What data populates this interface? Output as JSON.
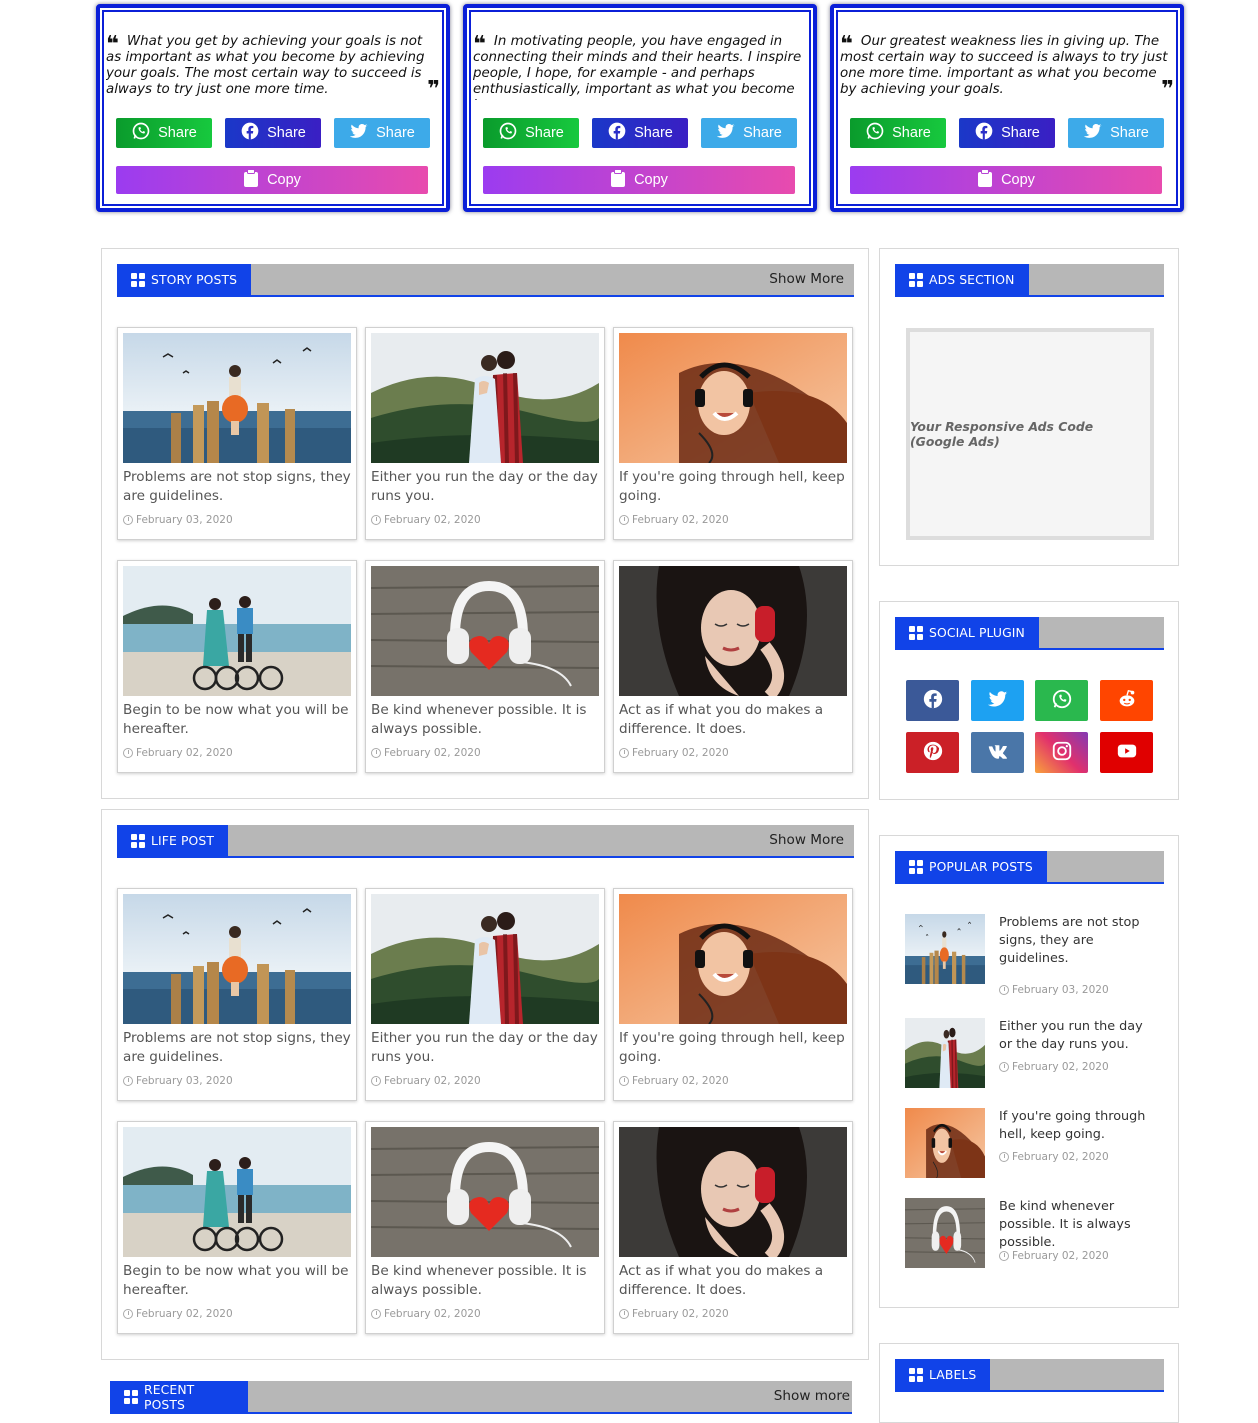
{
  "quotes": [
    {
      "text": "What you get by achieving your goals is not as important as what you become by achieving your goals. The most certain way to succeed is always to try just one more time."
    },
    {
      "text": "In motivating people, you have engaged in connecting their minds and their hearts. I inspire people, I hope, for example - and perhaps enthusiastically, important as what you become by"
    },
    {
      "text": "Our greatest weakness lies in giving up. The most certain way to succeed is always to try just one more time. important as what you become by achieving your goals."
    }
  ],
  "share_buttons": {
    "whatsapp": "Share",
    "facebook": "Share",
    "twitter": "Share",
    "copy": "Copy"
  },
  "story_section": {
    "title": "STORY POSTS",
    "show_more": "Show More"
  },
  "life_section": {
    "title": "LIFE POST",
    "show_more": "Show More"
  },
  "recent_section": {
    "title": "RECENT POSTS",
    "show_more": "Show more"
  },
  "posts": [
    {
      "title": "Problems are not stop signs, they are guidelines.",
      "date": "February 03, 2020",
      "image": "guitar-girl-pier"
    },
    {
      "title": "Either you run the day or the day runs you.",
      "date": "February 02, 2020",
      "image": "couple-hug-mountains"
    },
    {
      "title": "If you're going through hell, keep going.",
      "date": "February 02, 2020",
      "image": "woman-headphones-orange"
    },
    {
      "title": "Begin to be now what you will be hereafter.",
      "date": "February 02, 2020",
      "image": "couple-bicycles-beach"
    },
    {
      "title": "Be kind whenever possible. It is always possible.",
      "date": "February 02, 2020",
      "image": "headphones-heart-wood"
    },
    {
      "title": "Act as if what you do makes a difference. It does.",
      "date": "February 02, 2020",
      "image": "woman-red-headphones"
    }
  ],
  "sidebar": {
    "ads_title": "ADS SECTION",
    "ads_text": "Your Responsive Ads Code (Google Ads)",
    "social_title": "SOCIAL PLUGIN",
    "social_icons": [
      "facebook-icon",
      "twitter-icon",
      "whatsapp-icon",
      "reddit-icon",
      "pinterest-icon",
      "vk-icon",
      "instagram-icon",
      "youtube-icon"
    ],
    "popular_title": "POPULAR POSTS",
    "popular": [
      {
        "title": "Problems are not stop signs, they are guidelines.",
        "date": "February 03, 2020"
      },
      {
        "title": "Either you run the day or the day runs you.",
        "date": "February 02, 2020"
      },
      {
        "title": "If you're going through hell, keep going.",
        "date": "February 02, 2020"
      },
      {
        "title": "Be kind whenever possible. It is always possible.",
        "date": "February 02, 2020"
      }
    ],
    "labels_title": "LABELS"
  },
  "colors": {
    "accent": "#1143e8",
    "quote_border": "#0b1fd8",
    "bar_gray": "#b7b7b7"
  }
}
